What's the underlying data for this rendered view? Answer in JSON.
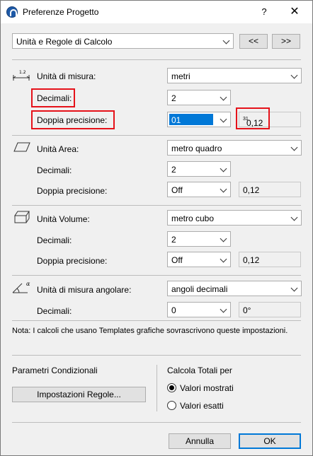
{
  "window": {
    "title": "Preferenze Progetto",
    "help": "?",
    "close": "✕"
  },
  "top": {
    "category": "Unità e Regole di Calcolo",
    "prev": "<<",
    "next": ">>"
  },
  "length": {
    "label": "Unità di misura:",
    "unit": "metri",
    "decimals_label": "Decimali:",
    "decimals": "2",
    "precision_label": "Doppia precisione:",
    "precision": "01",
    "preview": "0,12",
    "preview_sup": "31"
  },
  "area": {
    "label": "Unità Area:",
    "unit": "metro quadro",
    "decimals_label": "Decimali:",
    "decimals": "2",
    "precision_label": "Doppia precisione:",
    "precision": "Off",
    "preview": "0,12"
  },
  "volume": {
    "label": "Unità Volume:",
    "unit": "metro cubo",
    "decimals_label": "Decimali:",
    "decimals": "2",
    "precision_label": "Doppia precisione:",
    "precision": "Off",
    "preview": "0,12"
  },
  "angle": {
    "label": "Unità di misura angolare:",
    "unit": "angoli decimali",
    "decimals_label": "Decimali:",
    "decimals": "0",
    "preview": "0°"
  },
  "note": "Nota: I calcoli che usano Templates grafiche sovrascrivono queste impostazioni.",
  "conditional": {
    "title": "Parametri Condizionali",
    "button": "Impostazioni Regole..."
  },
  "totals": {
    "title": "Calcola Totali per",
    "option1": "Valori mostrati",
    "option2": "Valori esatti",
    "selected": "Valori mostrati"
  },
  "footer": {
    "cancel": "Annulla",
    "ok": "OK"
  },
  "colors": {
    "highlight": "#e5121a",
    "selection": "#0078d7"
  }
}
